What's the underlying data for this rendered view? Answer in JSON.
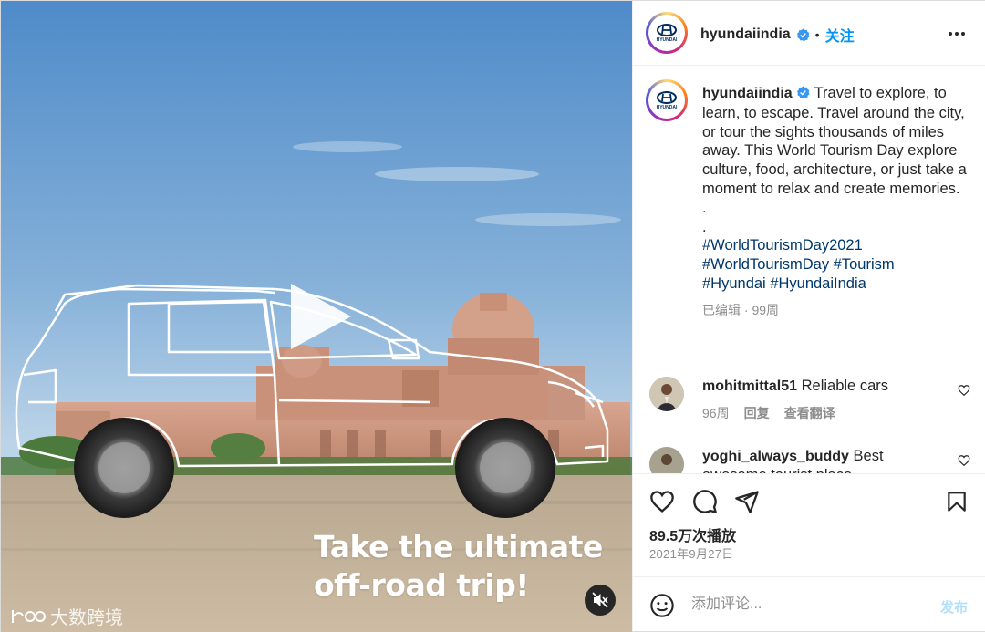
{
  "media": {
    "overlay_line1": "Take the ultimate",
    "overlay_line2": "off-road trip!",
    "watermark_text": "大数跨境",
    "controls": {
      "play_icon": "play-icon",
      "mute_icon": "muted-speaker-icon"
    }
  },
  "header": {
    "username": "hyundaiindia",
    "separator": "•",
    "follow_label": "关注",
    "more_icon": "more-dots-icon"
  },
  "caption": {
    "username": "hyundaiindia",
    "body": "Travel to explore, to learn, to escape. Travel around the city, or tour the sights thousands of miles away. This World Tourism Day explore culture, food, architecture, or just take a moment to relax and create memories.",
    "dot1": ".",
    "dot2": ".",
    "hashtags": [
      "#WorldTourismDay2021",
      "#WorldTourismDay",
      "#Tourism",
      "#Hyundai",
      "#HyundaiIndia"
    ],
    "edited": "已编辑",
    "meta_sep": " · ",
    "age": "99周"
  },
  "comments": [
    {
      "username": "mohitmittal51",
      "text": "Reliable cars",
      "age": "96周",
      "reply": "回复",
      "translate": "查看翻译"
    },
    {
      "username": "yoghi_always_buddy",
      "text": "Best",
      "text_cut": "awesome tourist place"
    }
  ],
  "actions": {
    "like_icon": "heart-icon",
    "comment_icon": "comment-bubble-icon",
    "share_icon": "paper-plane-icon",
    "save_icon": "bookmark-icon",
    "views": "89.5万次播放",
    "date": "2021年9月27日"
  },
  "comment_box": {
    "placeholder": "添加评论...",
    "post_label": "发布",
    "emoji_icon": "emoji-smile-icon"
  },
  "colors": {
    "link": "#0095f6",
    "hashtag": "#00376b",
    "muted": "#8e8e8e"
  }
}
